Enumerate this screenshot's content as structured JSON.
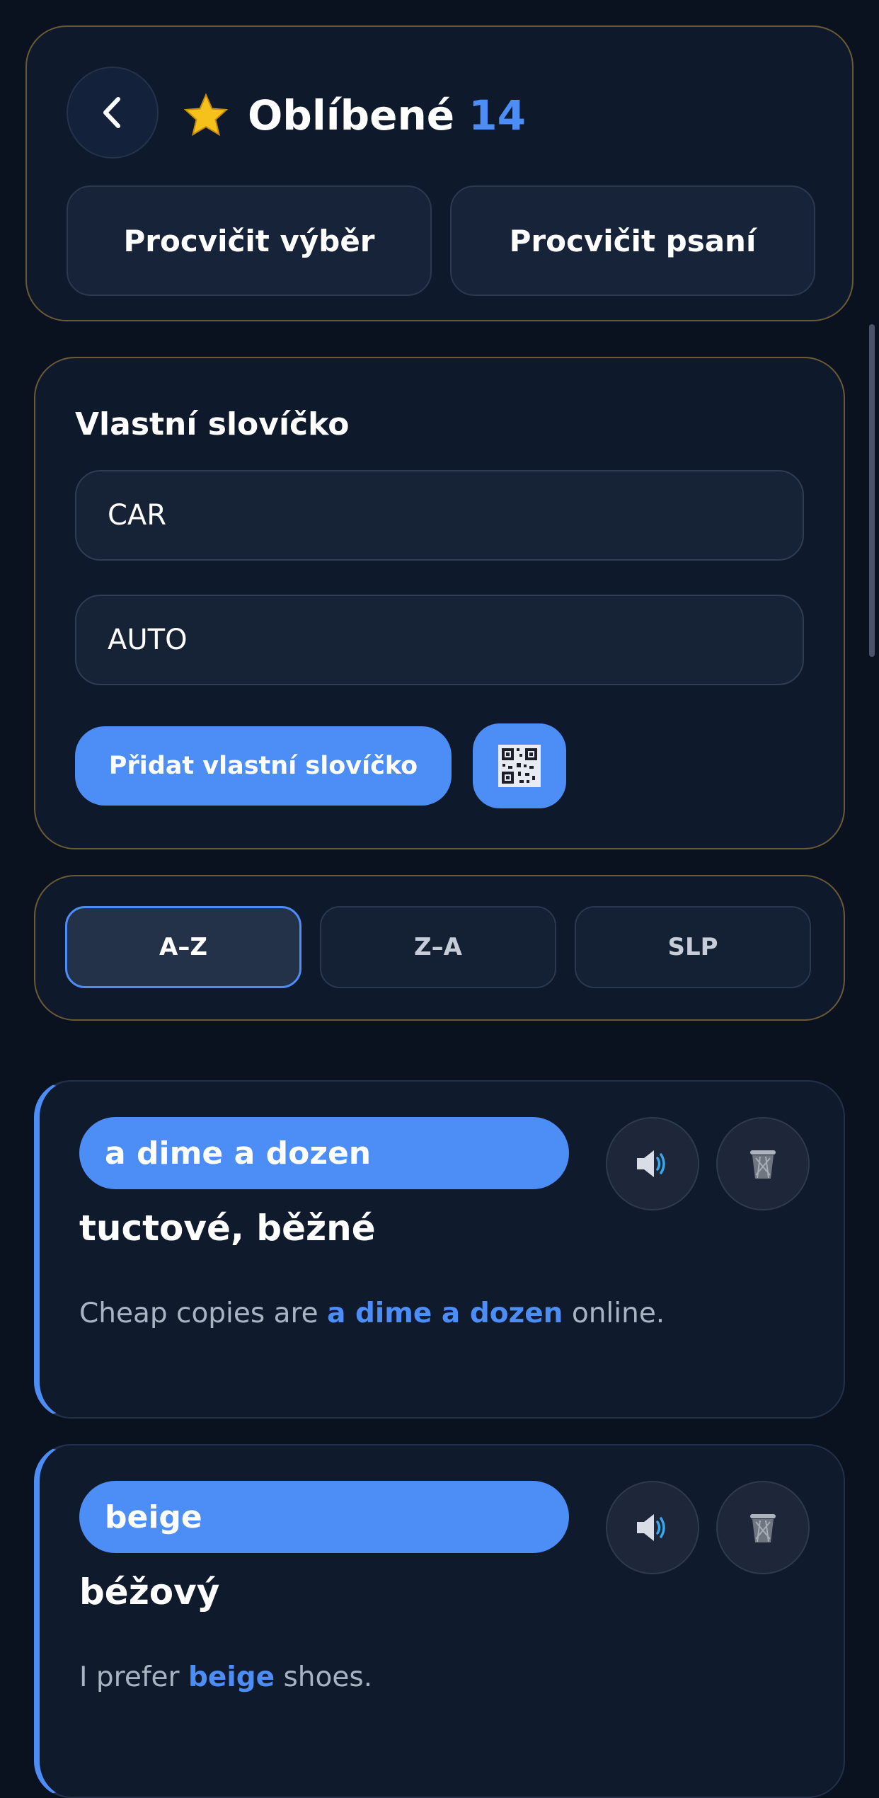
{
  "header": {
    "title": "Oblíbené",
    "count": "14",
    "practice_select": "Procvičit výběr",
    "practice_write": "Procvičit psaní"
  },
  "custom_word": {
    "title": "Vlastní slovíčko",
    "english_value": "CAR",
    "czech_value": "AUTO",
    "add_button": "Přidat vlastní slovíčko"
  },
  "sort": {
    "options": [
      "A–Z",
      "Z–A",
      "SLP"
    ],
    "active": "A–Z"
  },
  "words": [
    {
      "word": "a dime a dozen",
      "translation": "tuctové, běžné",
      "example_before": "Cheap copies are ",
      "example_highlight": "a dime a dozen",
      "example_after": " online."
    },
    {
      "word": "beige",
      "translation": "béžový",
      "example_before": "I prefer ",
      "example_highlight": "beige",
      "example_after": " shoes."
    }
  ],
  "colors": {
    "accent": "#4c8df6",
    "background": "#0a1220",
    "panel_border": "#6b5a35",
    "star": "#f5c21b"
  },
  "icons": {
    "back": "chevron-left-icon",
    "star": "star-icon",
    "qr": "qr-code-icon",
    "speak": "speaker-icon",
    "delete": "trash-icon"
  }
}
